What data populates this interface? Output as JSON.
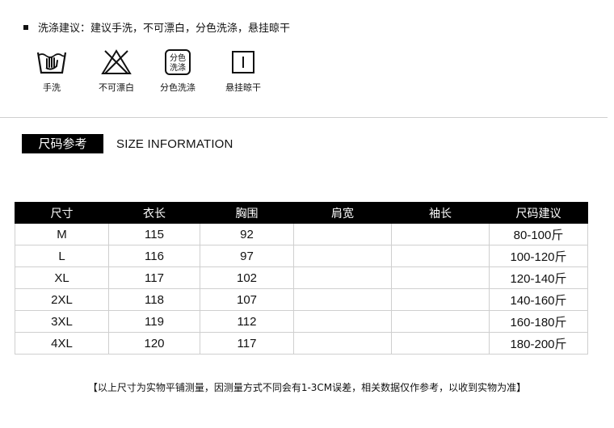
{
  "wash": {
    "title": "洗涤建议：建议手洗，不可漂白，分色洗涤，悬挂晾干",
    "icons": [
      {
        "icon": "hand-wash-icon",
        "label": "手洗"
      },
      {
        "icon": "no-bleach-icon",
        "label": "不可漂白"
      },
      {
        "icon": "wash-separately-icon",
        "label": "分色洗涤",
        "glyph_top": "分色",
        "glyph_bottom": "洗涤"
      },
      {
        "icon": "hang-dry-icon",
        "label": "悬挂晾干"
      }
    ]
  },
  "size_section": {
    "badge": "尺码参考",
    "title_en": "SIZE INFORMATION"
  },
  "size_table": {
    "headers": [
      "尺寸",
      "衣长",
      "胸围",
      "肩宽",
      "袖长",
      "尺码建议"
    ],
    "rows": [
      [
        "M",
        "115",
        "92",
        "",
        "",
        "80-100斤"
      ],
      [
        "L",
        "116",
        "97",
        "",
        "",
        "100-120斤"
      ],
      [
        "XL",
        "117",
        "102",
        "",
        "",
        "120-140斤"
      ],
      [
        "2XL",
        "118",
        "107",
        "",
        "",
        "140-160斤"
      ],
      [
        "3XL",
        "119",
        "112",
        "",
        "",
        "160-180斤"
      ],
      [
        "4XL",
        "120",
        "117",
        "",
        "",
        "180-200斤"
      ]
    ]
  },
  "note": "【以上尺寸为实物平铺测量，因测量方式不同会有1-3CM误差，相关数据仅作参考，以收到实物为准】"
}
